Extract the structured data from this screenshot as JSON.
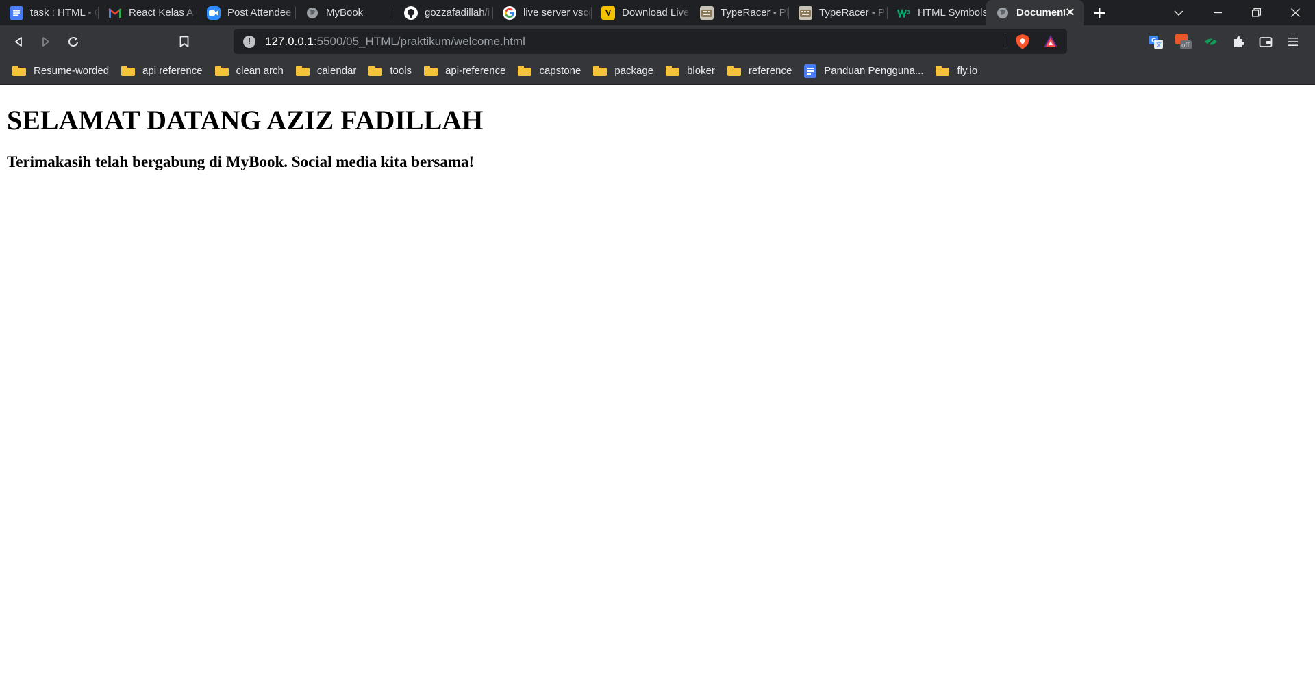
{
  "tabs": [
    {
      "label": "task : HTML - G",
      "icon": "google-docs-icon"
    },
    {
      "label": "React Kelas A C",
      "icon": "gmail-icon"
    },
    {
      "label": "Post Attendee",
      "icon": "zoom-icon"
    },
    {
      "label": "MyBook",
      "icon": "globe-icon"
    },
    {
      "label": "gozzafadillah/i",
      "icon": "github-icon"
    },
    {
      "label": "live server vsco",
      "icon": "google-icon"
    },
    {
      "label": "Download Live",
      "icon": "v-logo-icon"
    },
    {
      "label": "TypeRacer - Pla",
      "icon": "typeracer-icon"
    },
    {
      "label": "TypeRacer - Pla",
      "icon": "typeracer-icon"
    },
    {
      "label": "HTML Symbols",
      "icon": "w3schools-icon"
    },
    {
      "label": "Document",
      "icon": "globe-icon",
      "active": true
    }
  ],
  "address_bar": {
    "host": "127.0.0.1",
    "path": ":5500/05_HTML/praktikum/welcome.html"
  },
  "bookmarks": [
    {
      "label": "Resume-worded",
      "icon": "folder-icon"
    },
    {
      "label": "api reference",
      "icon": "folder-icon"
    },
    {
      "label": "clean arch",
      "icon": "folder-icon"
    },
    {
      "label": "calendar",
      "icon": "folder-icon"
    },
    {
      "label": "tools",
      "icon": "folder-icon"
    },
    {
      "label": "api-reference",
      "icon": "folder-icon"
    },
    {
      "label": "capstone",
      "icon": "folder-icon"
    },
    {
      "label": "package",
      "icon": "folder-icon"
    },
    {
      "label": "bloker",
      "icon": "folder-icon"
    },
    {
      "label": "reference",
      "icon": "folder-icon"
    },
    {
      "label": "Panduan Pengguna...",
      "icon": "google-docs-icon"
    },
    {
      "label": "fly.io",
      "icon": "folder-icon"
    }
  ],
  "page": {
    "title": "SELAMAT DATANG AZIZ FADILLAH",
    "subtitle": "Terimakasih telah bergabung di MyBook. Social media kita bersama!"
  },
  "colors": {
    "tab_strip": "#1f2023",
    "toolbar": "#35363a",
    "omnibox": "#1f2023",
    "folder": "#f5c33b",
    "page_background": "#ffffff"
  }
}
